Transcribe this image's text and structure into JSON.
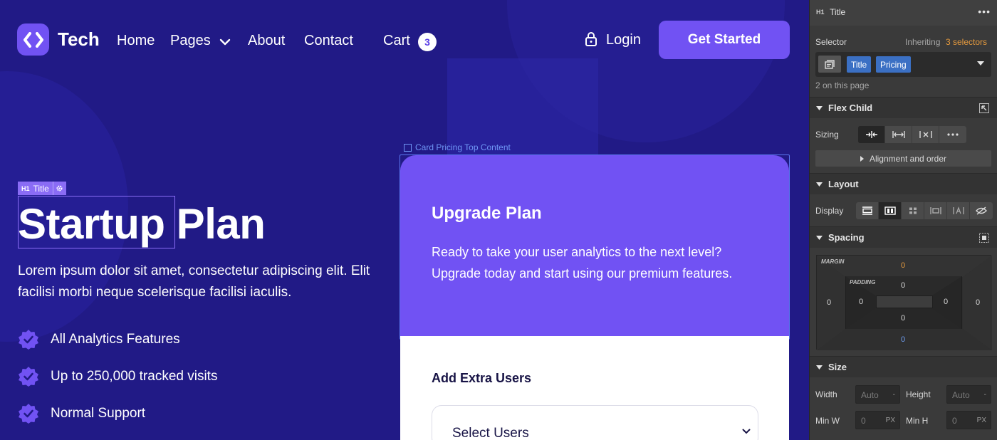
{
  "nav": {
    "logo_text": "Tech",
    "links": [
      "Home",
      "Pages",
      "About",
      "Contact"
    ],
    "cart_label": "Cart",
    "cart_count": "3",
    "login_label": "Login",
    "cta_label": "Get Started"
  },
  "hero": {
    "selection_tag": {
      "h1": "H1",
      "label": "Title"
    },
    "title": "Startup Plan",
    "description": "Lorem ipsum dolor sit amet, consectetur adipiscing elit. Elit facilisi morbi neque scelerisque facilisi iaculis.",
    "features": [
      "All Analytics Features",
      "Up to 250,000 tracked visits",
      "Normal Support"
    ]
  },
  "pricing_card": {
    "element_label": "Card Pricing Top Content",
    "title": "Upgrade Plan",
    "description": "Ready to take your user analytics to the next level? Upgrade today and start using our premium features.",
    "extra_title": "Add Extra Users",
    "select_value": "Select Users"
  },
  "style_panel": {
    "header": {
      "tag": "H1",
      "title": "Title",
      "more": "•••"
    },
    "selector": {
      "label": "Selector",
      "inheriting_prefix": "Inheriting",
      "inheriting_link": "3 selectors",
      "chips": [
        "Title",
        "Pricing"
      ],
      "on_page": "2 on this page"
    },
    "flex_child": {
      "title": "Flex Child",
      "sizing_label": "Sizing",
      "alignment_label": "Alignment and order"
    },
    "layout": {
      "title": "Layout",
      "display_label": "Display"
    },
    "spacing": {
      "title": "Spacing",
      "margin_label": "MARGIN",
      "padding_label": "PADDING",
      "margin": {
        "top": "0",
        "right": "0",
        "bottom": "0",
        "left": "0"
      },
      "padding": {
        "top": "0",
        "right": "0",
        "bottom": "0",
        "left": "0"
      }
    },
    "size": {
      "title": "Size",
      "width_label": "Width",
      "height_label": "Height",
      "width_value": "Auto",
      "height_value": "Auto",
      "min_w_label": "Min W",
      "min_h_label": "Min H",
      "min_w_value": "0",
      "min_h_value": "0",
      "unit": "PX",
      "dash": "-"
    }
  },
  "colors": {
    "canvas_bg": "#211a86",
    "accent": "#7152f3",
    "panel_bg": "#3a3a3a",
    "chip_blue": "#3b70c4",
    "orange": "#e59a3e"
  }
}
